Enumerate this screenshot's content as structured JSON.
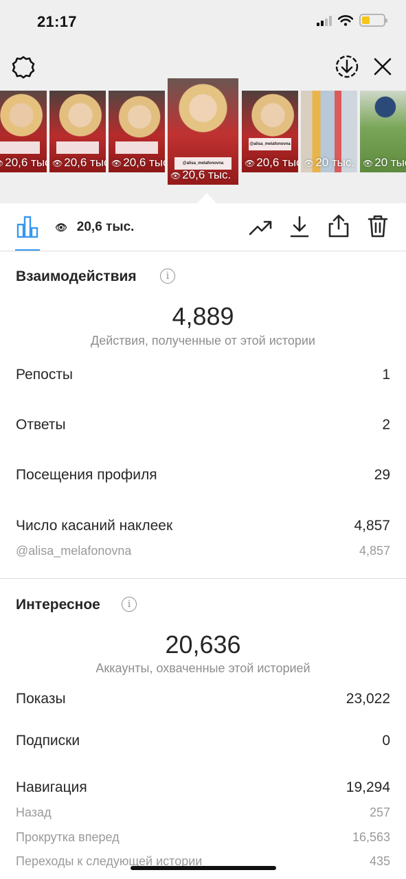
{
  "status_bar": {
    "time": "21:17"
  },
  "thumbnails": [
    {
      "views": "20,6 тыс.",
      "tag": ""
    },
    {
      "views": "20,6 тыс.",
      "tag": ""
    },
    {
      "views": "20,6 тыс.",
      "tag": ""
    },
    {
      "views": "20,6 тыс.",
      "tag": "@alisa_melafonovna",
      "active": true
    },
    {
      "views": "20,6 тыс.",
      "tag": "@alisa_melafonovna"
    },
    {
      "views": "20 тыс.",
      "tag": ""
    },
    {
      "views": "20 тыс.",
      "tag": ""
    }
  ],
  "toolbar": {
    "views": "20,6 тыс."
  },
  "interactions": {
    "title": "Взаимодействия",
    "total": "4,889",
    "total_label": "Действия, полученные от этой истории",
    "rows": [
      {
        "label": "Репосты",
        "value": "1"
      },
      {
        "label": "Ответы",
        "value": "2"
      },
      {
        "label": "Посещения профиля",
        "value": "29"
      },
      {
        "label": "Число касаний наклеек",
        "value": "4,857"
      }
    ],
    "sticker_sub": {
      "label": "@alisa_melafonovna",
      "value": "4,857"
    }
  },
  "discovery": {
    "title": "Интересное",
    "total": "20,636",
    "total_label": "Аккаунты, охваченные этой историей",
    "rows": [
      {
        "label": "Показы",
        "value": "23,022"
      },
      {
        "label": "Подписки",
        "value": "0"
      },
      {
        "label": "Навигация",
        "value": "19,294"
      }
    ],
    "nav_sub": [
      {
        "label": "Назад",
        "value": "257"
      },
      {
        "label": "Прокрутка вперед",
        "value": "16,563"
      },
      {
        "label": "Переходы к следующей истории",
        "value": "435"
      }
    ]
  },
  "colors": {
    "accent": "#3897f0",
    "battery": "#f5c518",
    "muted": "#8e8e8e"
  }
}
